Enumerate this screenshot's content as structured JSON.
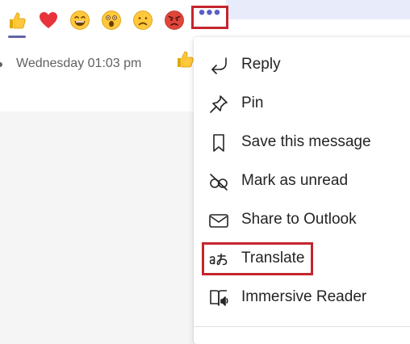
{
  "reactions": [
    {
      "name": "like",
      "glyph": "👍",
      "selected": true
    },
    {
      "name": "heart",
      "glyph": "❤",
      "selected": false
    },
    {
      "name": "laugh",
      "glyph": "😆",
      "selected": false
    },
    {
      "name": "surprised",
      "glyph": "😮",
      "selected": false
    },
    {
      "name": "sad",
      "glyph": "☹",
      "selected": false
    },
    {
      "name": "angry",
      "glyph": "😡",
      "selected": false
    }
  ],
  "more_options": {
    "label": "•••"
  },
  "message": {
    "timestamp": "Wednesday 01:03 pm"
  },
  "menu": {
    "items": [
      {
        "label": "Reply",
        "icon": "reply-icon"
      },
      {
        "label": "Pin",
        "icon": "pin-icon"
      },
      {
        "label": "Save this message",
        "icon": "bookmark-icon"
      },
      {
        "label": "Mark as unread",
        "icon": "mark-unread-icon"
      },
      {
        "label": "Share to Outlook",
        "icon": "mail-icon"
      },
      {
        "label": "Translate",
        "icon": "translate-icon"
      },
      {
        "label": "Immersive Reader",
        "icon": "immersive-reader-icon"
      }
    ]
  },
  "colors": {
    "accent": "#5b5fc7",
    "highlight_border": "#c4262e",
    "text": "#242424",
    "muted_text": "#616161"
  }
}
